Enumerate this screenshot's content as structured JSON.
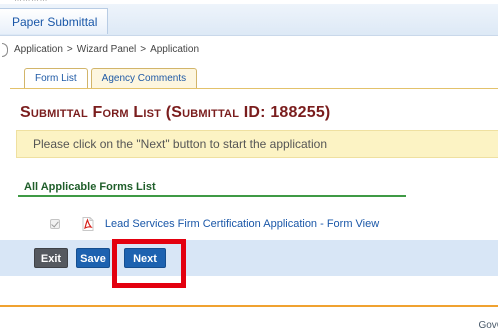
{
  "top_strip": {
    "text": "…………"
  },
  "nav": {
    "tab_label": "Paper Submittal"
  },
  "breadcrumb": {
    "items": [
      "Application",
      "Wizard Panel",
      "Application"
    ],
    "separator": ">"
  },
  "tabs": [
    {
      "label": "Form List",
      "active": true
    },
    {
      "label": "Agency Comments",
      "active": false
    }
  ],
  "page": {
    "title": "Submittal Form List (Submittal ID: 188255)"
  },
  "notice": {
    "text": "Please click on the \"Next\" button to start the application"
  },
  "forms_section": {
    "header": "All Applicable Forms List",
    "items": [
      {
        "checked": true,
        "icon": "pdf-icon",
        "label": "Lead Services Firm Certification Application - Form View"
      }
    ]
  },
  "buttons": {
    "exit": "Exit",
    "save": "Save",
    "next": "Next"
  },
  "footer": {
    "text": "GovC"
  },
  "colors": {
    "title": "#7a1d1d",
    "link": "#1a57a8",
    "notice_bg": "#fcf3c4",
    "section_rule": "#3f9a45",
    "button_bar": "#d8e6f6",
    "highlight": "#e3000f",
    "footer_rule": "#f0a230"
  }
}
